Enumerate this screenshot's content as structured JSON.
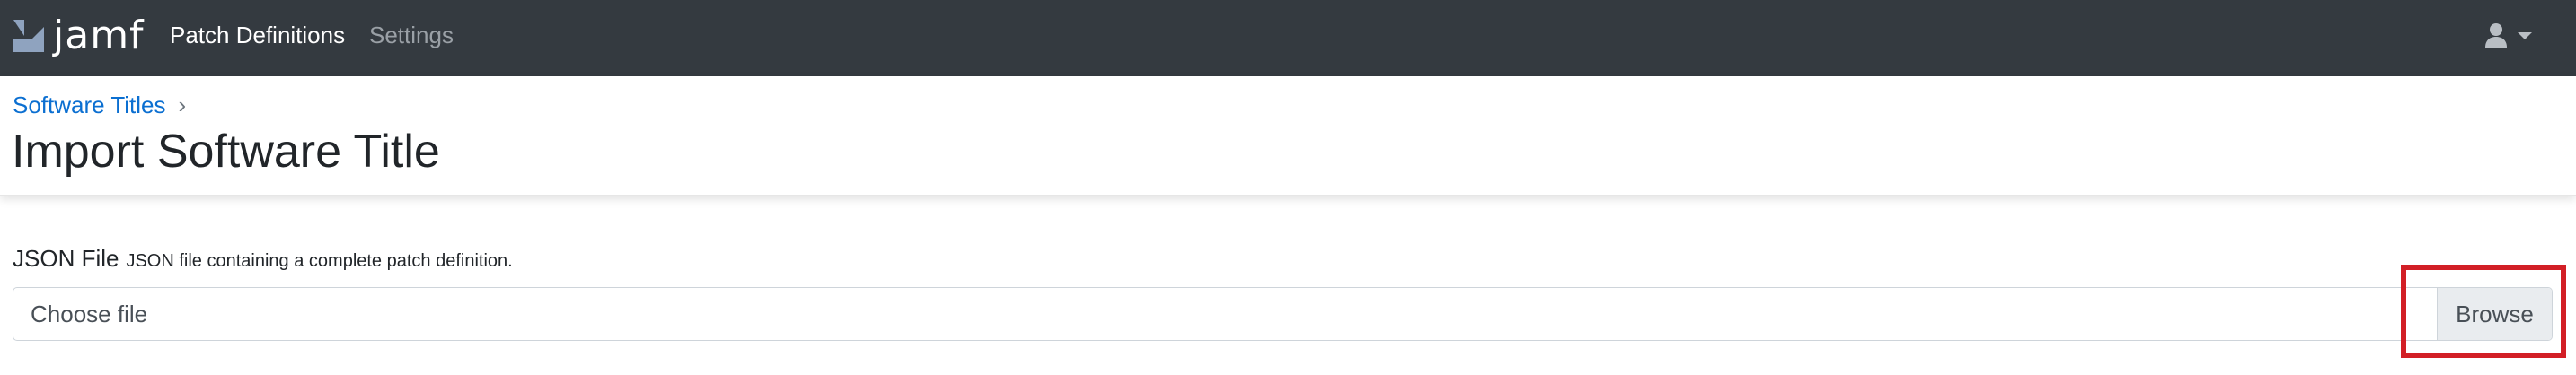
{
  "navbar": {
    "logo_text": "jamf",
    "nav_items": [
      {
        "label": "Patch Definitions",
        "active": true
      },
      {
        "label": "Settings",
        "active": false
      }
    ],
    "user_icon": "user-icon",
    "dropdown_icon": "caret-down-icon",
    "background": "#343a40"
  },
  "breadcrumb": {
    "items": [
      {
        "label": "Software Titles"
      }
    ],
    "separator": "›"
  },
  "page": {
    "title": "Import Software Title"
  },
  "form": {
    "json_file": {
      "label": "JSON File",
      "help": "JSON file containing a complete patch definition.",
      "placeholder": "Choose file",
      "browse_label": "Browse"
    }
  },
  "colors": {
    "link": "#0b6fd1",
    "highlight": "#d21f26"
  }
}
